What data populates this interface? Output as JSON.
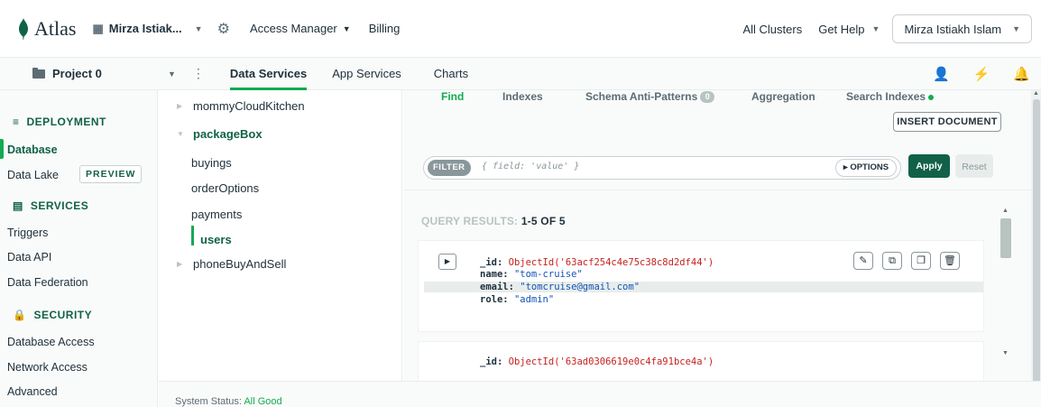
{
  "topbar": {
    "brand": "Atlas",
    "org_name": "Mirza Istiak...",
    "access_manager": "Access Manager",
    "billing": "Billing",
    "all_clusters": "All Clusters",
    "get_help": "Get Help",
    "user_name": "Mirza Istiakh Islam"
  },
  "subbar": {
    "project": "Project 0",
    "tabs": [
      {
        "label": "Data Services",
        "active": true
      },
      {
        "label": "App Services",
        "active": false
      }
    ],
    "charts": "Charts"
  },
  "leftnav": {
    "deployment": "DEPLOYMENT",
    "database": "Database",
    "data_lake": "Data Lake",
    "preview": "PREVIEW",
    "services": "SERVICES",
    "triggers": "Triggers",
    "data_api": "Data API",
    "data_federation": "Data Federation",
    "security": "SECURITY",
    "database_access": "Database Access",
    "network_access": "Network Access",
    "advanced": "Advanced"
  },
  "collections": {
    "db1": "mommyCloudKitchen",
    "db2": "packageBox",
    "items": [
      "buyings",
      "orderOptions",
      "payments",
      "users"
    ],
    "db3": "phoneBuyAndSell"
  },
  "main": {
    "tabs": [
      "Find",
      "Indexes",
      "Schema Anti-Patterns",
      "Aggregation",
      "Search Indexes"
    ],
    "anti_pattern_count": "0",
    "insert_document": "INSERT DOCUMENT",
    "filter_tag": "FILTER",
    "filter_placeholder": "{ field: 'value' }",
    "options": "▸ OPTIONS",
    "apply": "Apply",
    "reset": "Reset",
    "query_results_label": "QUERY RESULTS:",
    "query_results_count": "1-5 OF 5",
    "doc1": {
      "id_key": "_id:",
      "id_val": "ObjectId('63acf254c4e75c38c8d2df44')",
      "name_key": "name:",
      "name_val": "\"tom-cruise\"",
      "email_key": "email:",
      "email_val": "\"tomcruise@gmail.com\"",
      "role_key": "role:",
      "role_val": "\"admin\""
    },
    "doc2": {
      "id_key": "_id:",
      "id_val": "ObjectId('63ad0306619e0c4fa91bce4a')"
    }
  },
  "footer": {
    "status_label": "System Status:",
    "status_value": "All Good"
  },
  "colors": {
    "brand_green": "#13aa52",
    "dark_green": "#116149"
  }
}
